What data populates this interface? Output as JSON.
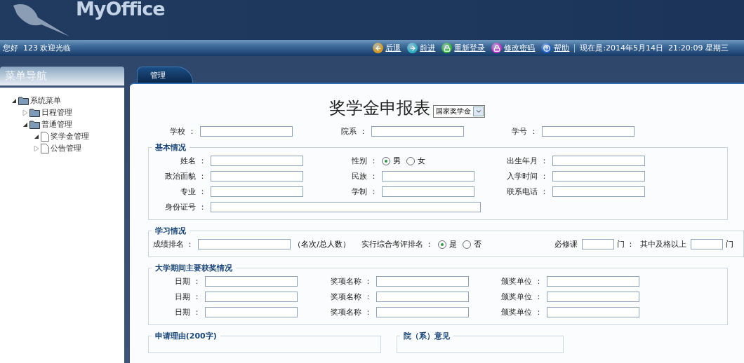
{
  "header": {
    "logo": "MyOffice",
    "greeting": "您好  123 欢迎光临",
    "links": [
      {
        "kind": "back",
        "label": "后退"
      },
      {
        "kind": "forward",
        "label": "前进"
      },
      {
        "kind": "relogin",
        "label": "重新登录"
      },
      {
        "kind": "password",
        "label": "修改密码"
      },
      {
        "kind": "help",
        "label": "帮助"
      }
    ],
    "clock": "现在是:2014年5月14日  21:20:09 星期三"
  },
  "sidebar": {
    "title": "菜单导航",
    "tree": [
      {
        "label": "系统菜单",
        "kind": "folder",
        "expanded": true,
        "children": [
          {
            "label": "日程管理",
            "kind": "folder",
            "expanded": false
          },
          {
            "label": "普通管理",
            "kind": "folder",
            "expanded": true,
            "children": [
              {
                "label": "奖学金管理",
                "kind": "file",
                "expanded": true
              },
              {
                "label": "公告管理",
                "kind": "file",
                "expanded": false
              }
            ]
          }
        ]
      }
    ]
  },
  "tabs": [
    {
      "label": "管理",
      "selected": true
    }
  ],
  "form": {
    "title": "奖学金申报表",
    "type_select": "国家奖学金",
    "top_fields": [
      {
        "kind": "text",
        "label": "学校 ："
      },
      {
        "kind": "text",
        "label": "院系 ："
      },
      {
        "kind": "text",
        "label": "学号 ："
      }
    ],
    "sections": [
      {
        "kind": "grid",
        "title": "基本情况",
        "fields": [
          {
            "kind": "text",
            "label": "姓名 ："
          },
          {
            "kind": "radio",
            "label": "性别 ：",
            "options": [
              {
                "label": "男",
                "selected": true
              },
              {
                "label": "女",
                "selected": false
              }
            ]
          },
          {
            "kind": "text",
            "label": "出生年月 ："
          },
          {
            "kind": "text",
            "label": "政治面貌 ："
          },
          {
            "kind": "text",
            "label": "民族 ："
          },
          {
            "kind": "text",
            "label": "入学时间 ："
          },
          {
            "kind": "text",
            "label": "专业 ："
          },
          {
            "kind": "text",
            "label": "学制 ："
          },
          {
            "kind": "text",
            "label": "联系电话 ："
          },
          {
            "kind": "wide",
            "label": "身份证号 ："
          }
        ]
      },
      {
        "kind": "line",
        "title": "学习情况",
        "fields": [
          {
            "kind": "text",
            "label": "成绩排名 ：",
            "note": "（名次/总人数）"
          },
          {
            "kind": "radio",
            "label": "实行综合考评排名 ：",
            "options": [
              {
                "label": "是",
                "selected": true
              },
              {
                "label": "否",
                "selected": false
              }
            ]
          },
          {
            "kind": "count",
            "label": "必修课",
            "unit": "门 ："
          },
          {
            "kind": "count",
            "label": "其中及格以上",
            "unit": "门"
          }
        ]
      },
      {
        "kind": "grid",
        "title": "大学期间主要获奖情况",
        "fields": [
          {
            "kind": "text",
            "label": "日期 ："
          },
          {
            "kind": "text",
            "label": "奖项名称 ："
          },
          {
            "kind": "text",
            "label": "颁奖单位 ："
          },
          {
            "kind": "text",
            "label": "日期 ："
          },
          {
            "kind": "text",
            "label": "奖项名称 ："
          },
          {
            "kind": "text",
            "label": "颁奖单位 ："
          },
          {
            "kind": "text",
            "label": "日期 ："
          },
          {
            "kind": "text",
            "label": "奖项名称 ："
          },
          {
            "kind": "text",
            "label": "颁奖单位 ："
          }
        ]
      }
    ],
    "bottom_sections": [
      {
        "title": "申请理由(200字)"
      },
      {
        "title": "院（系）意见"
      }
    ]
  }
}
